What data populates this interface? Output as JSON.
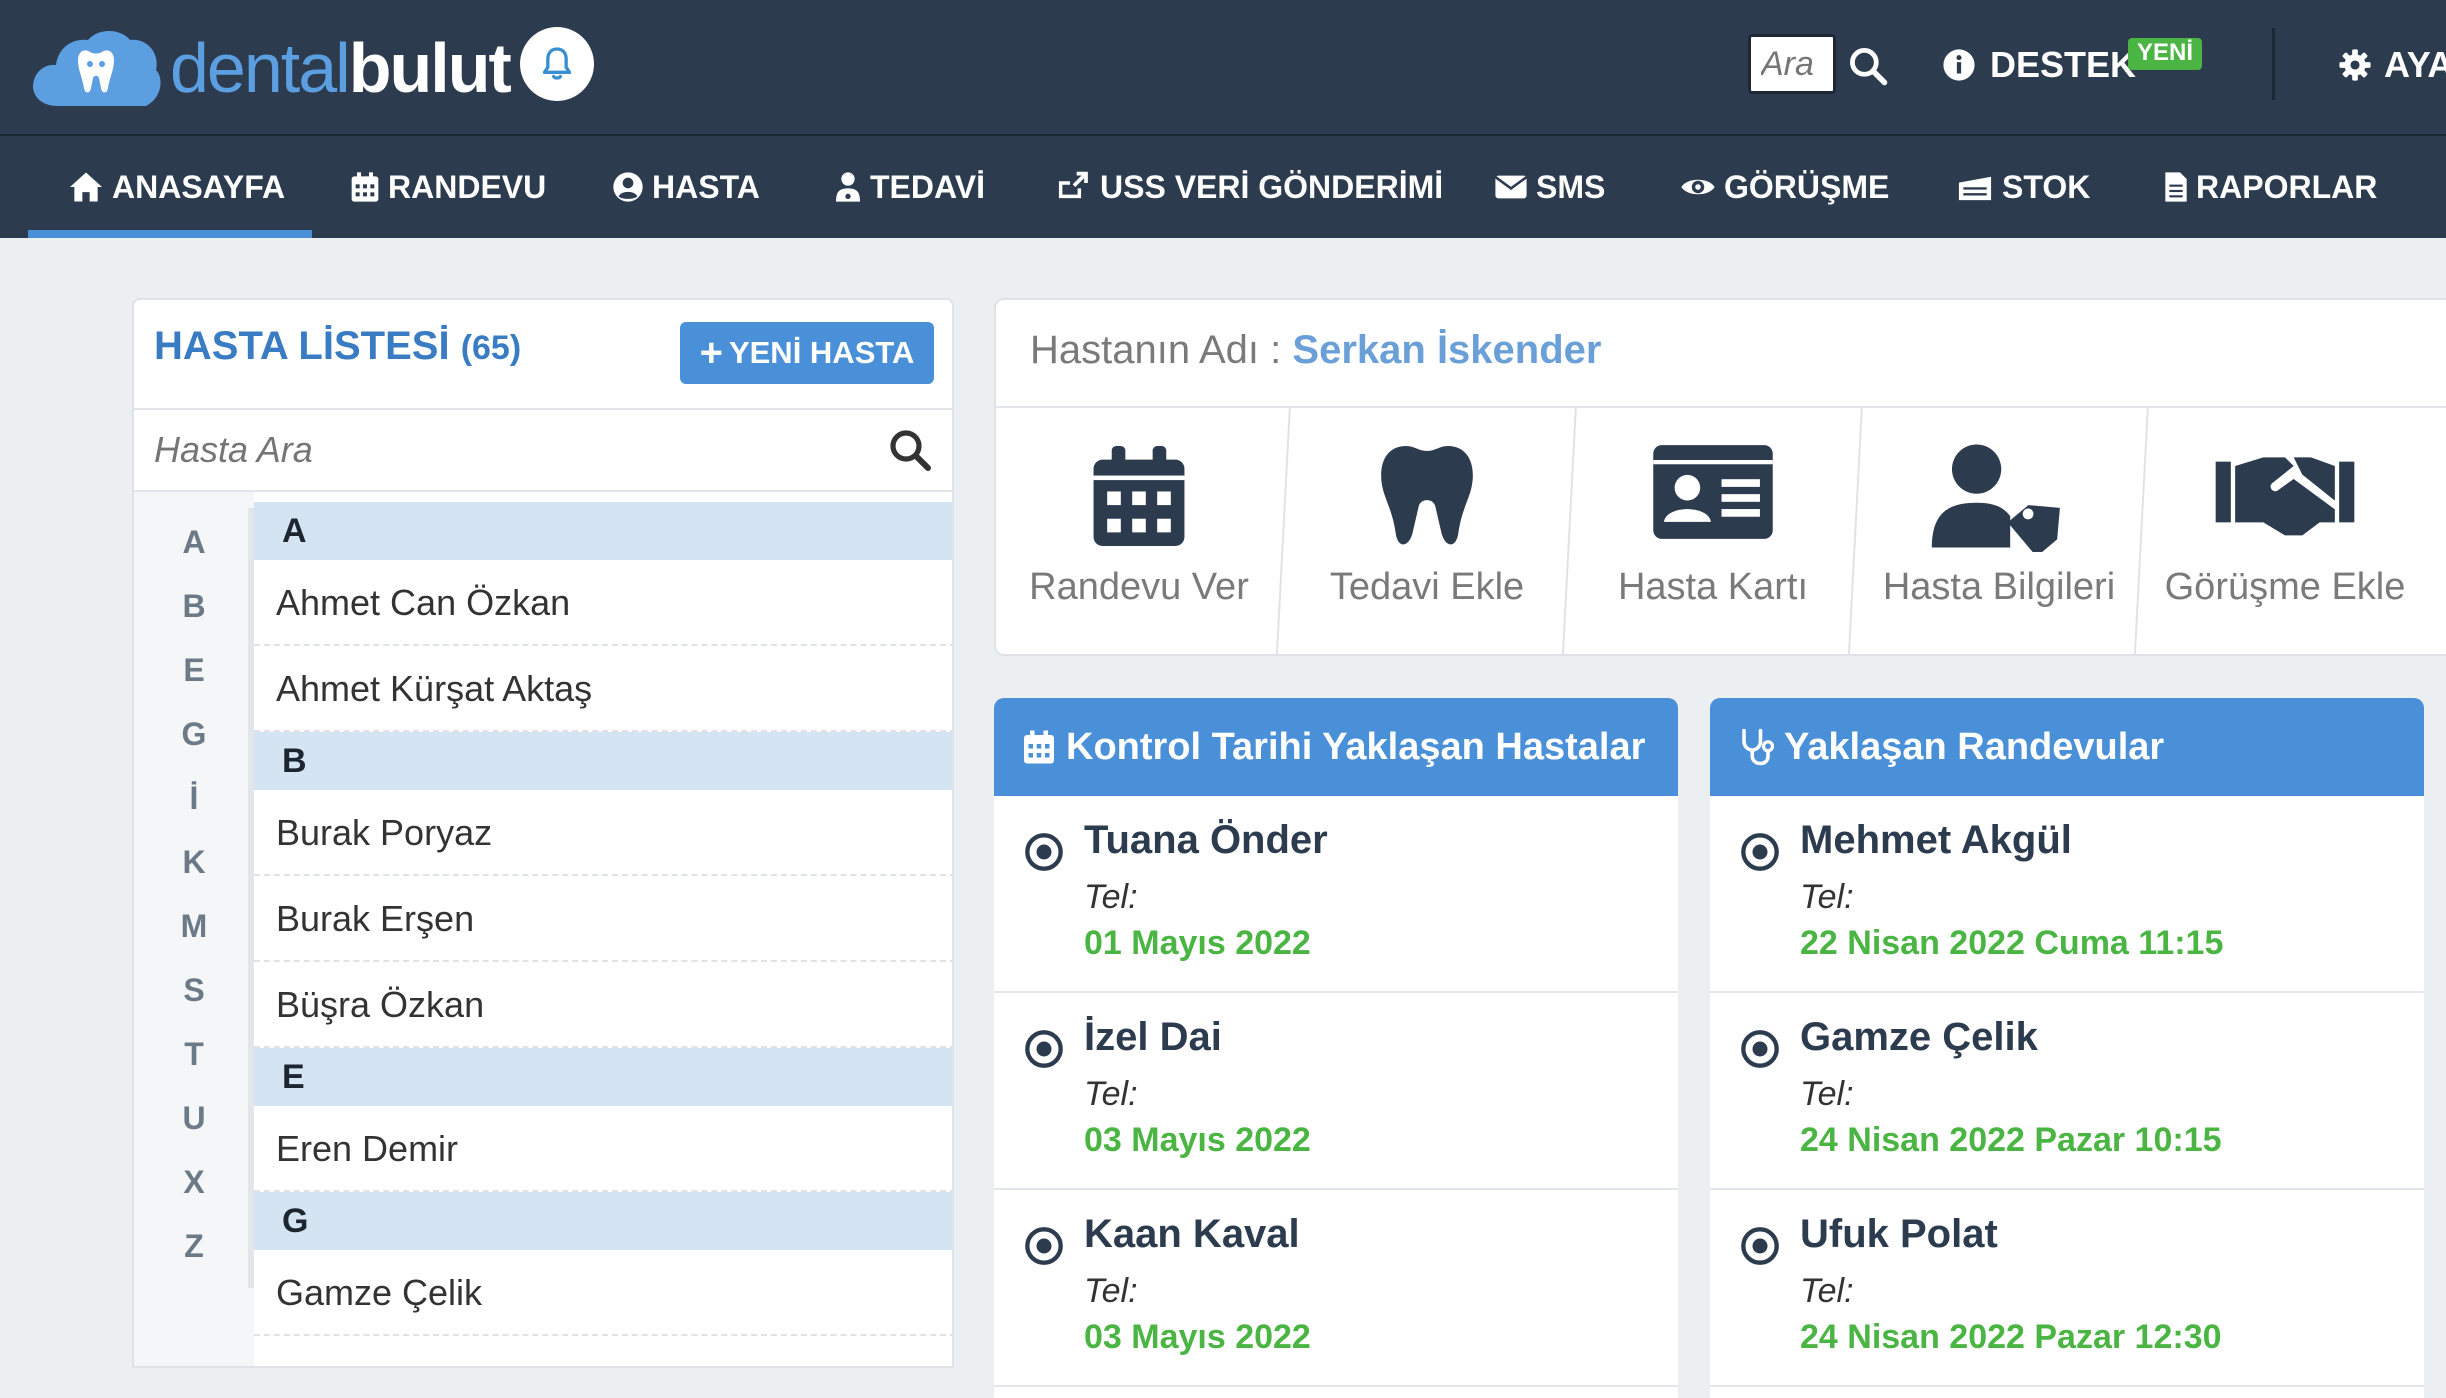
{
  "brand": {
    "name_part1": "dental",
    "name_part2": "bulut"
  },
  "header": {
    "search_placeholder": "Ara",
    "support_label": "DESTEK",
    "support_badge": "YENİ",
    "settings_label": "AYARLAR"
  },
  "nav": [
    {
      "label": "ANASAYFA",
      "icon": "home-icon",
      "active": true
    },
    {
      "label": "RANDEVU",
      "icon": "calendar-icon"
    },
    {
      "label": "HASTA",
      "icon": "user-circle-icon"
    },
    {
      "label": "TEDAVİ",
      "icon": "user-md-icon"
    },
    {
      "label": "USS VERİ GÖNDERİMİ",
      "icon": "share-icon"
    },
    {
      "label": "SMS",
      "icon": "envelope-icon"
    },
    {
      "label": "GÖRÜŞME",
      "icon": "eye-icon"
    },
    {
      "label": "STOK",
      "icon": "inbox-icon"
    },
    {
      "label": "RAPORLAR",
      "icon": "file-icon"
    }
  ],
  "patient_list": {
    "title": "HASTA LİSTESİ",
    "count": "(65)",
    "new_button": "YENİ HASTA",
    "search_placeholder": "Hasta Ara",
    "letters": [
      "A",
      "B",
      "E",
      "G",
      "İ",
      "K",
      "M",
      "S",
      "T",
      "U",
      "X",
      "Z"
    ],
    "groups": [
      {
        "letter": "A",
        "patients": [
          "Ahmet Can Özkan",
          "Ahmet Kürşat Aktaş"
        ]
      },
      {
        "letter": "B",
        "patients": [
          "Burak Poryaz",
          "Burak Erşen",
          "Büşra Özkan"
        ]
      },
      {
        "letter": "E",
        "patients": [
          "Eren Demir"
        ]
      },
      {
        "letter": "G",
        "patients": [
          "Gamze Çelik"
        ]
      }
    ]
  },
  "patient_detail": {
    "label": "Hastanın Adı :",
    "name": "Serkan İskender",
    "actions": [
      {
        "label": "Randevu Ver",
        "icon": "calendar-icon"
      },
      {
        "label": "Tedavi Ekle",
        "icon": "tooth-icon"
      },
      {
        "label": "Hasta Kartı",
        "icon": "id-card-icon"
      },
      {
        "label": "Hasta Bilgileri",
        "icon": "user-tag-icon"
      },
      {
        "label": "Görüşme Ekle",
        "icon": "handshake-icon"
      }
    ]
  },
  "control_widget": {
    "title": "Kontrol Tarihi Yaklaşan Hastalar",
    "items": [
      {
        "name": "Tuana Önder",
        "tel": "Tel:",
        "date": "01 Mayıs 2022"
      },
      {
        "name": "İzel Dai",
        "tel": "Tel:",
        "date": "03 Mayıs 2022"
      },
      {
        "name": "Kaan Kaval",
        "tel": "Tel:",
        "date": "03 Mayıs 2022"
      }
    ]
  },
  "appointments_widget": {
    "title": "Yaklaşan Randevular",
    "items": [
      {
        "name": "Mehmet Akgül",
        "tel": "Tel:",
        "date": "22 Nisan 2022 Cuma 11:15"
      },
      {
        "name": "Gamze Çelik",
        "tel": "Tel:",
        "date": "24 Nisan 2022 Pazar 10:15"
      },
      {
        "name": "Ufuk Polat",
        "tel": "Tel:",
        "date": "24 Nisan 2022 Pazar 12:30"
      }
    ]
  },
  "colors": {
    "header_bg": "#2c3b4e",
    "accent_blue": "#4a90d9",
    "green": "#4bb543",
    "group_header_bg": "#d5e4f2"
  }
}
